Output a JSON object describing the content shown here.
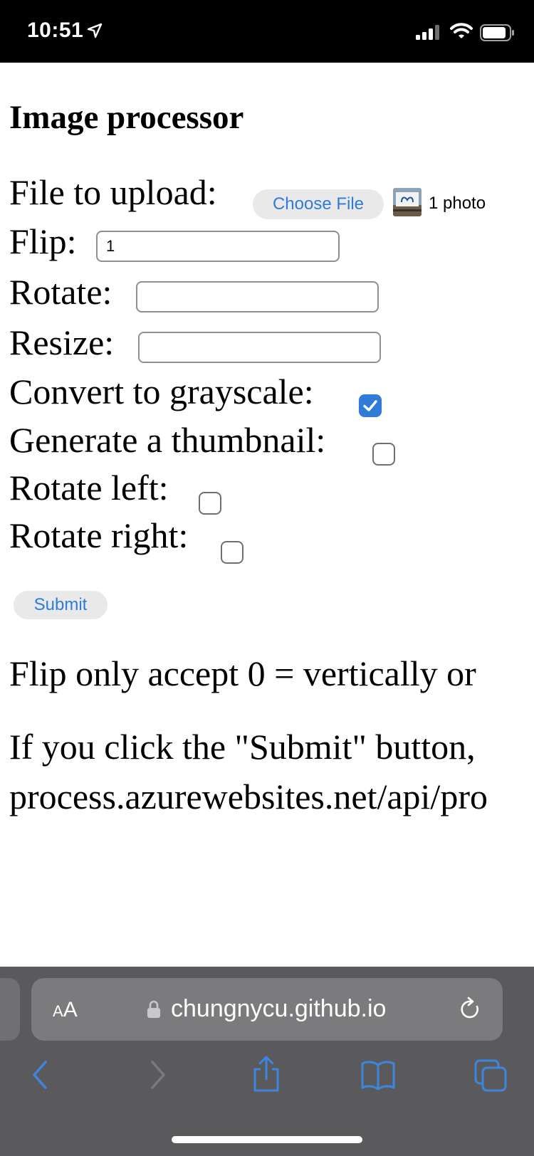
{
  "status_bar": {
    "time": "10:51"
  },
  "page": {
    "title": "Image processor",
    "file_label": "File to upload:",
    "choose_file_label": "Choose File",
    "file_status": "1 photo",
    "flip_label": "Flip:",
    "flip_value": "1",
    "rotate_label": "Rotate:",
    "rotate_value": "",
    "resize_label": "Resize:",
    "resize_value": "",
    "grayscale_label": "Convert to grayscale:",
    "grayscale_checked": true,
    "thumbnail_label": "Generate a thumbnail:",
    "thumbnail_checked": false,
    "rotate_left_label": "Rotate left:",
    "rotate_left_checked": false,
    "rotate_right_label": "Rotate right:",
    "rotate_right_checked": false,
    "submit_label": "Submit",
    "note_flip": "Flip only accept 0 = vertically or",
    "note_submit_line1": "If you click the \"Submit\" button,",
    "note_submit_line2": "process.azurewebsites.net/api/pro"
  },
  "browser": {
    "text_size_label_big": "A",
    "text_size_label_small": "A",
    "domain": "chungnycu.github.io"
  },
  "colors": {
    "accent": "#2f7bd9",
    "toolbar": "#5a5a5c",
    "urlbar": "#7b7b7e"
  },
  "icons": [
    "location-arrow-icon",
    "signal-icon",
    "wifi-icon",
    "battery-icon",
    "lock-icon",
    "reload-icon",
    "back-icon",
    "forward-icon",
    "share-icon",
    "bookmarks-icon",
    "tabs-icon"
  ]
}
